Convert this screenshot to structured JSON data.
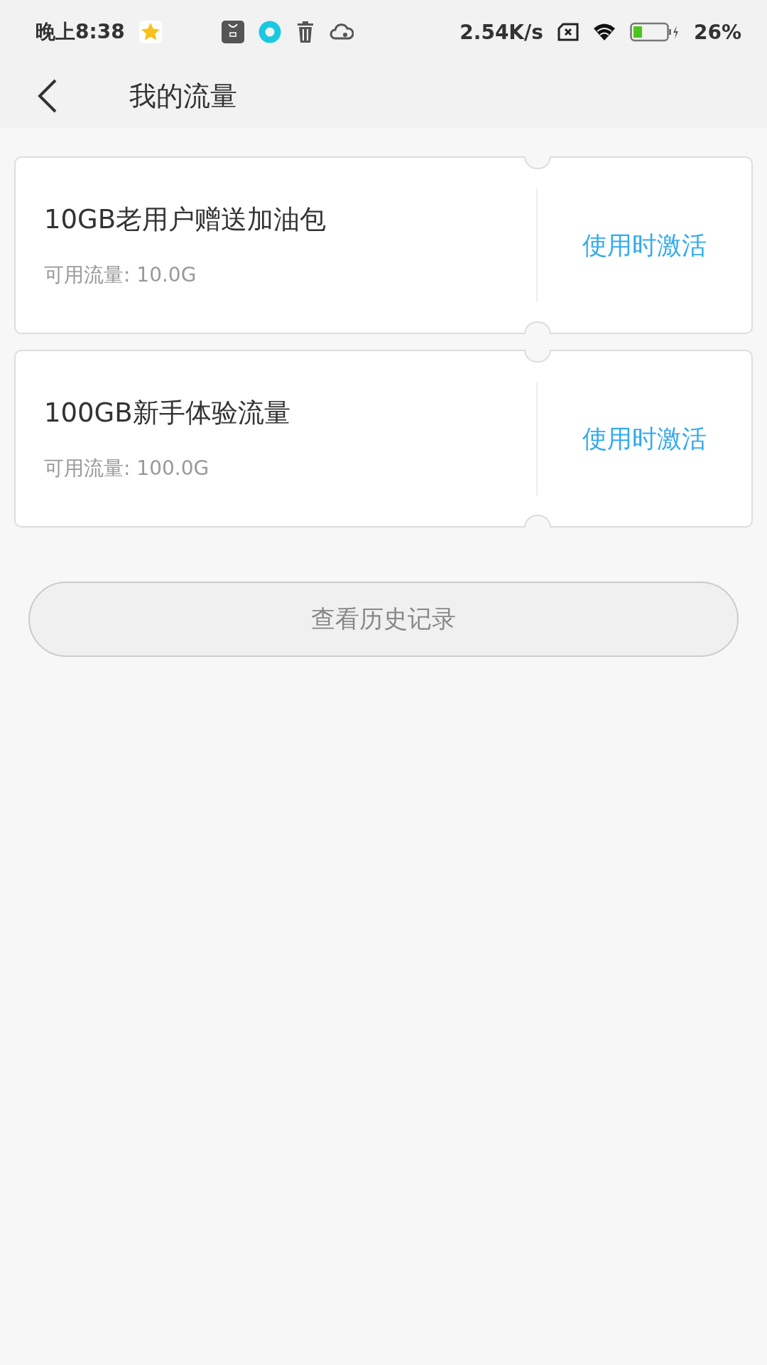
{
  "status_bar": {
    "time": "晚上8:38",
    "speed": "2.54K/s",
    "battery": "26%"
  },
  "header": {
    "title": "我的流量"
  },
  "packages": [
    {
      "name": "10GB老用户赠送加油包",
      "available": "可用流量: 10.0G",
      "action": "使用时激活"
    },
    {
      "name": "100GB新手体验流量",
      "available": "可用流量: 100.0G",
      "action": "使用时激活"
    }
  ],
  "history_button": "查看历史记录"
}
